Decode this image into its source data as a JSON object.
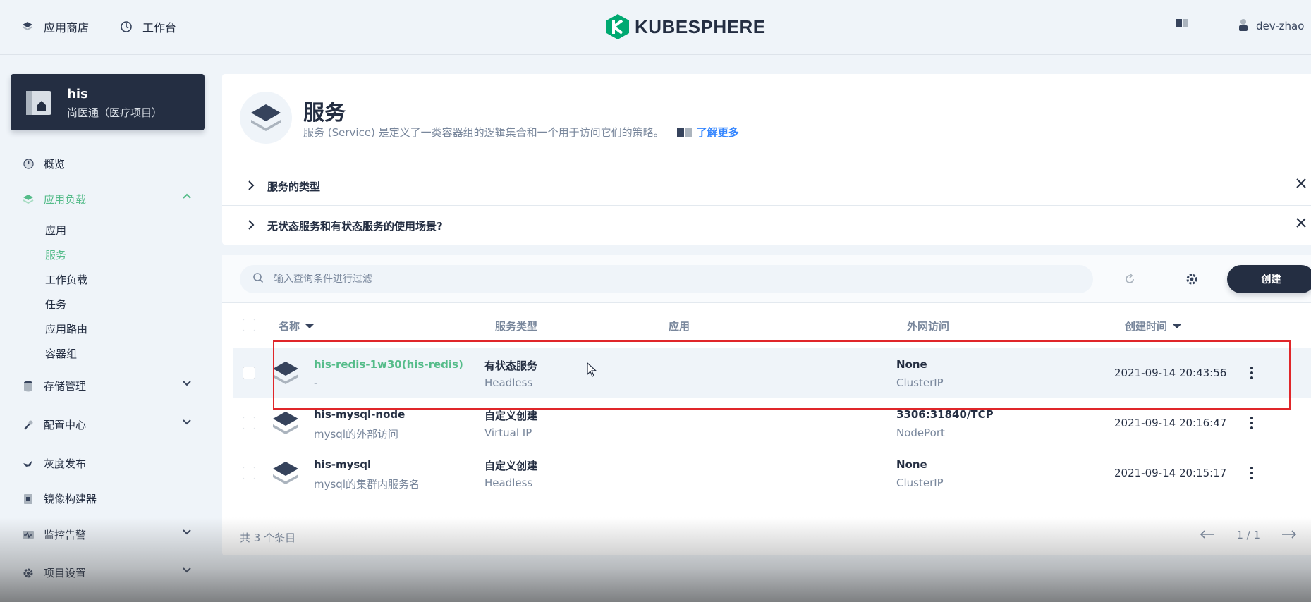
{
  "topbar": {
    "app_store": "应用商店",
    "workbench": "工作台",
    "logo": "KUBESPHERE",
    "user": "dev-zhao"
  },
  "project": {
    "name": "his",
    "desc": "尚医通（医疗项目）"
  },
  "sidebar": {
    "overview": "概览",
    "workloads": "应用负载",
    "sub": {
      "apps": "应用",
      "services": "服务",
      "workloads": "工作负载",
      "jobs": "任务",
      "routes": "应用路由",
      "pods": "容器组"
    },
    "storage": "存储管理",
    "config": "配置中心",
    "gray": "灰度发布",
    "image_builder": "镜像构建器",
    "monitoring": "监控告警",
    "settings": "项目设置"
  },
  "banner": {
    "title": "服务",
    "desc": "服务 (Service) 是定义了一类容器组的逻辑集合和一个用于访问它们的策略。",
    "learn_more": "了解更多"
  },
  "tips": [
    {
      "label": "服务的类型"
    },
    {
      "label": "无状态服务和有状态服务的使用场景?"
    }
  ],
  "toolbar": {
    "search_placeholder": "输入查询条件进行过滤",
    "create": "创建"
  },
  "table": {
    "headers": {
      "name": "名称",
      "type": "服务类型",
      "app": "应用",
      "external": "外网访问",
      "created": "创建时间"
    },
    "rows": [
      {
        "name": "his-redis-1w30(his-redis)",
        "sub": "-",
        "type": "有状态服务",
        "type_sub": "Headless",
        "ext": "None",
        "ext_sub": "ClusterIP",
        "time": "2021-09-14 20:43:56"
      },
      {
        "name": "his-mysql-node",
        "sub": "mysql的外部访问",
        "type": "自定义创建",
        "type_sub": "Virtual IP",
        "ext": "3306:31840/TCP",
        "ext_sub": "NodePort",
        "time": "2021-09-14 20:16:47"
      },
      {
        "name": "his-mysql",
        "sub": "mysql的集群内服务名",
        "type": "自定义创建",
        "type_sub": "Headless",
        "ext": "None",
        "ext_sub": "ClusterIP",
        "time": "2021-09-14 20:15:17"
      }
    ]
  },
  "footer": {
    "total": "共 3 个条目",
    "page": "1 / 1"
  },
  "colors": {
    "accent": "#55bc8a",
    "dark": "#242e42",
    "link": "#3385ff",
    "highlight_box": "#e0262a"
  }
}
